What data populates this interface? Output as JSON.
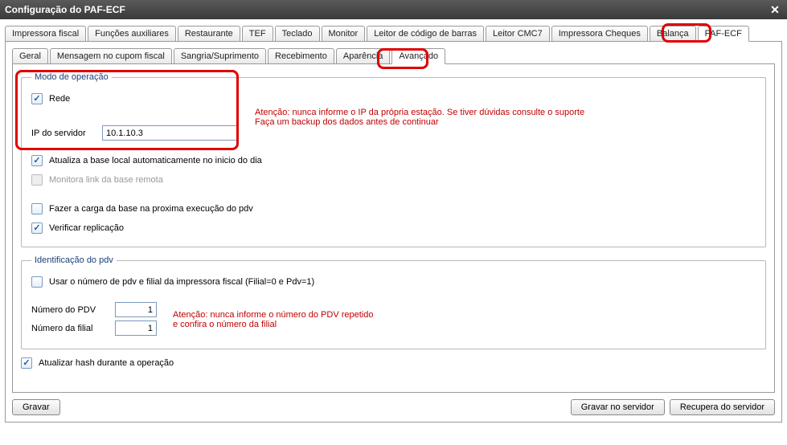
{
  "window": {
    "title": "Configuração do PAF-ECF"
  },
  "mainTabs": [
    "Impressora fiscal",
    "Funções auxiliares",
    "Restaurante",
    "TEF",
    "Teclado",
    "Monitor",
    "Leitor de código de barras",
    "Leitor CMC7",
    "Impressora Cheques",
    "Balança",
    "PAF-ECF"
  ],
  "subTabs": [
    "Geral",
    "Mensagem no cupom fiscal",
    "Sangria/Suprimento",
    "Recebimento",
    "Aparência",
    "Avançado"
  ],
  "modo": {
    "legend": "Modo de operação",
    "rede_label": "Rede",
    "ip_label": "IP do servidor",
    "ip_value": "10.1.10.3",
    "warn_line1": "Atenção: nunca informe o IP da própria estação. Se tiver dúvidas consulte o suporte",
    "warn_line2": "Faça um backup dos dados antes de continuar",
    "cb_atualiza": "Atualiza a base local automaticamente no inicio do dia",
    "cb_monitora": "Monitora link da base remota",
    "cb_carga": "Fazer a carga da base na proxima execução do pdv",
    "cb_replicacao": "Verificar replicação"
  },
  "ident": {
    "legend": "Identificação do pdv",
    "cb_usar": "Usar o número de pdv e filial da impressora fiscal (Filial=0 e Pdv=1)",
    "pdv_label": "Número do PDV",
    "pdv_value": "1",
    "filial_label": "Número da filial",
    "filial_value": "1",
    "warn_line1": "Atenção: nunca informe o número do PDV repetido",
    "warn_line2": "e confira o número da filial"
  },
  "hash": {
    "label": "Atualizar hash durante a operação"
  },
  "buttons": {
    "gravar": "Gravar",
    "gravar_servidor": "Gravar no servidor",
    "recupera": "Recupera do servidor"
  }
}
